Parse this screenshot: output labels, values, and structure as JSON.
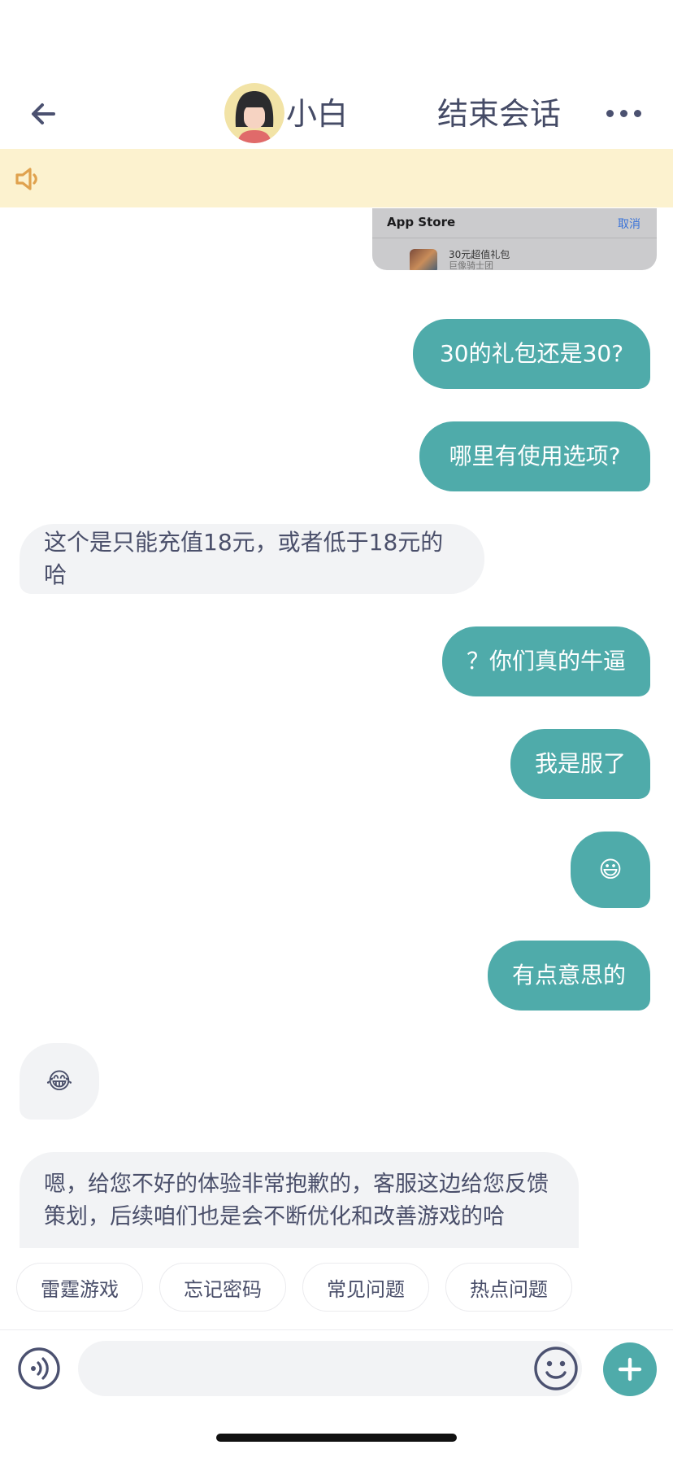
{
  "header": {
    "back_icon": "arrow-left-icon",
    "contact_name": "小白",
    "end_session_label": "结束会话",
    "more_icon": "more-horizontal-icon"
  },
  "notice": {
    "icon": "speaker-icon",
    "text": ""
  },
  "appstore_preview": {
    "title": "App Store",
    "cancel_label": "取消",
    "item_name": "30元超值礼包",
    "item_seller": "巨像骑士团"
  },
  "messages": [
    {
      "sender": "me",
      "text": "30的礼包还是30?"
    },
    {
      "sender": "me",
      "text": "哪里有使用选项?"
    },
    {
      "sender": "agent",
      "text": "这个是只能充值18元，或者低于18元的哈"
    },
    {
      "sender": "me",
      "text": "？你们真的牛逼"
    },
    {
      "sender": "me",
      "text": "我是服了"
    },
    {
      "sender": "me",
      "text": "😃"
    },
    {
      "sender": "me",
      "text": "有点意思的"
    },
    {
      "sender": "agent",
      "text": "😂"
    },
    {
      "sender": "agent",
      "text": "嗯，给您不好的体验非常抱歉的，客服这边给您反馈策划，后续咱们也是会不断优化和改善游戏的哈"
    }
  ],
  "quick_replies": [
    "雷霆游戏",
    "忘记密码",
    "常见问题",
    "热点问题"
  ],
  "input_bar": {
    "voice_icon": "voice-icon",
    "placeholder": "",
    "emoji_icon": "smiley-icon",
    "plus_icon": "plus-icon"
  },
  "colors": {
    "accent": "#4fabaa",
    "notice_bg": "#fcf2cf",
    "notice_icon": "#e0a24e",
    "agent_bubble": "#f2f3f5",
    "text": "#4a4f6a"
  }
}
